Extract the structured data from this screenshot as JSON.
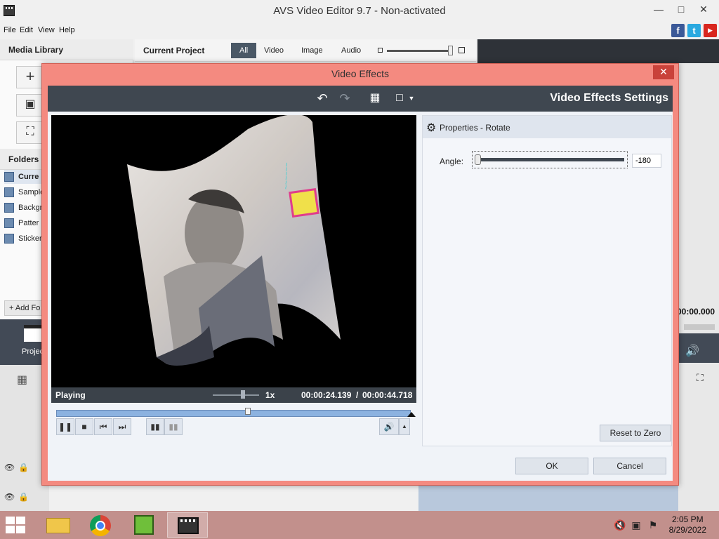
{
  "app": {
    "title": "AVS Video Editor 9.7 - Non-activated"
  },
  "menu": [
    "File",
    "Edit",
    "View",
    "Help"
  ],
  "left_panel": {
    "header": "Media Library",
    "folders_header": "Folders",
    "folders": [
      "Curre",
      "Sample",
      "Backgr",
      "Patter",
      "Sticker"
    ],
    "add_folder": "Add Fo",
    "project_label": "Projec"
  },
  "center": {
    "header": "Current Project",
    "filters": [
      "All",
      "Video",
      "Image",
      "Audio"
    ],
    "active_filter": "All"
  },
  "right_panel": {
    "timecode": "00:00.000"
  },
  "dialog": {
    "title": "Video Effects",
    "settings_title": "Video Effects Settings",
    "properties_title": "Properties - Rotate",
    "angle_label": "Angle:",
    "angle_value": "-180",
    "angle_fraction": 0.0,
    "player": {
      "status": "Playing",
      "speed": "1x",
      "current_time": "00:00:24.139",
      "separator": "/",
      "total_time": "00:00:44.718",
      "progress": 0.54
    },
    "reset_button": "Reset to Zero",
    "ok_button": "OK",
    "cancel_button": "Cancel"
  },
  "taskbar": {
    "time": "2:05 PM",
    "date": "8/29/2022"
  },
  "colors": {
    "dialog_border": "#f48a80",
    "toolbar_dark": "#3f4750",
    "seek_fill": "#8cb2e0",
    "taskbar": "#c2908c"
  }
}
